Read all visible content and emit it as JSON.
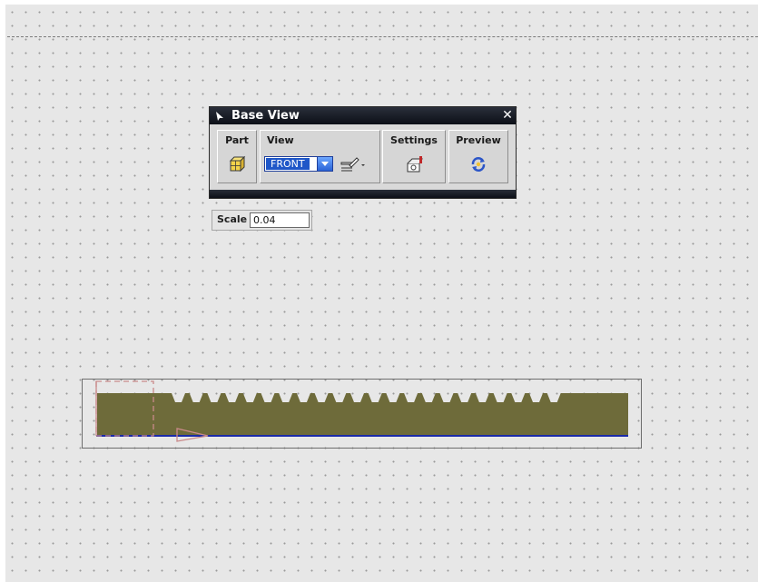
{
  "dialog": {
    "title": "Base View",
    "close_icon": "close-icon",
    "title_icon": "select-arrow-icon",
    "groups": {
      "part": {
        "label": "Part",
        "icon": "part-cube-icon"
      },
      "view": {
        "label": "View",
        "selected": "FRONT",
        "edit_icon": "view-style-icon"
      },
      "settings": {
        "label": "Settings",
        "icon": "settings-icon"
      },
      "preview": {
        "label": "Preview",
        "icon": "preview-refresh-icon"
      }
    }
  },
  "scale": {
    "label": "Scale",
    "value": "0.04"
  },
  "drawing": {
    "teeth": 22,
    "colors": {
      "rack_fill": "#6e6b3a",
      "base_line": "#1a2aa8",
      "datum": "#c98a8a"
    }
  },
  "colors": {
    "background": "#e7e7e7",
    "titlebar": "#0c0f17",
    "select_blue": "#1f57c8"
  }
}
